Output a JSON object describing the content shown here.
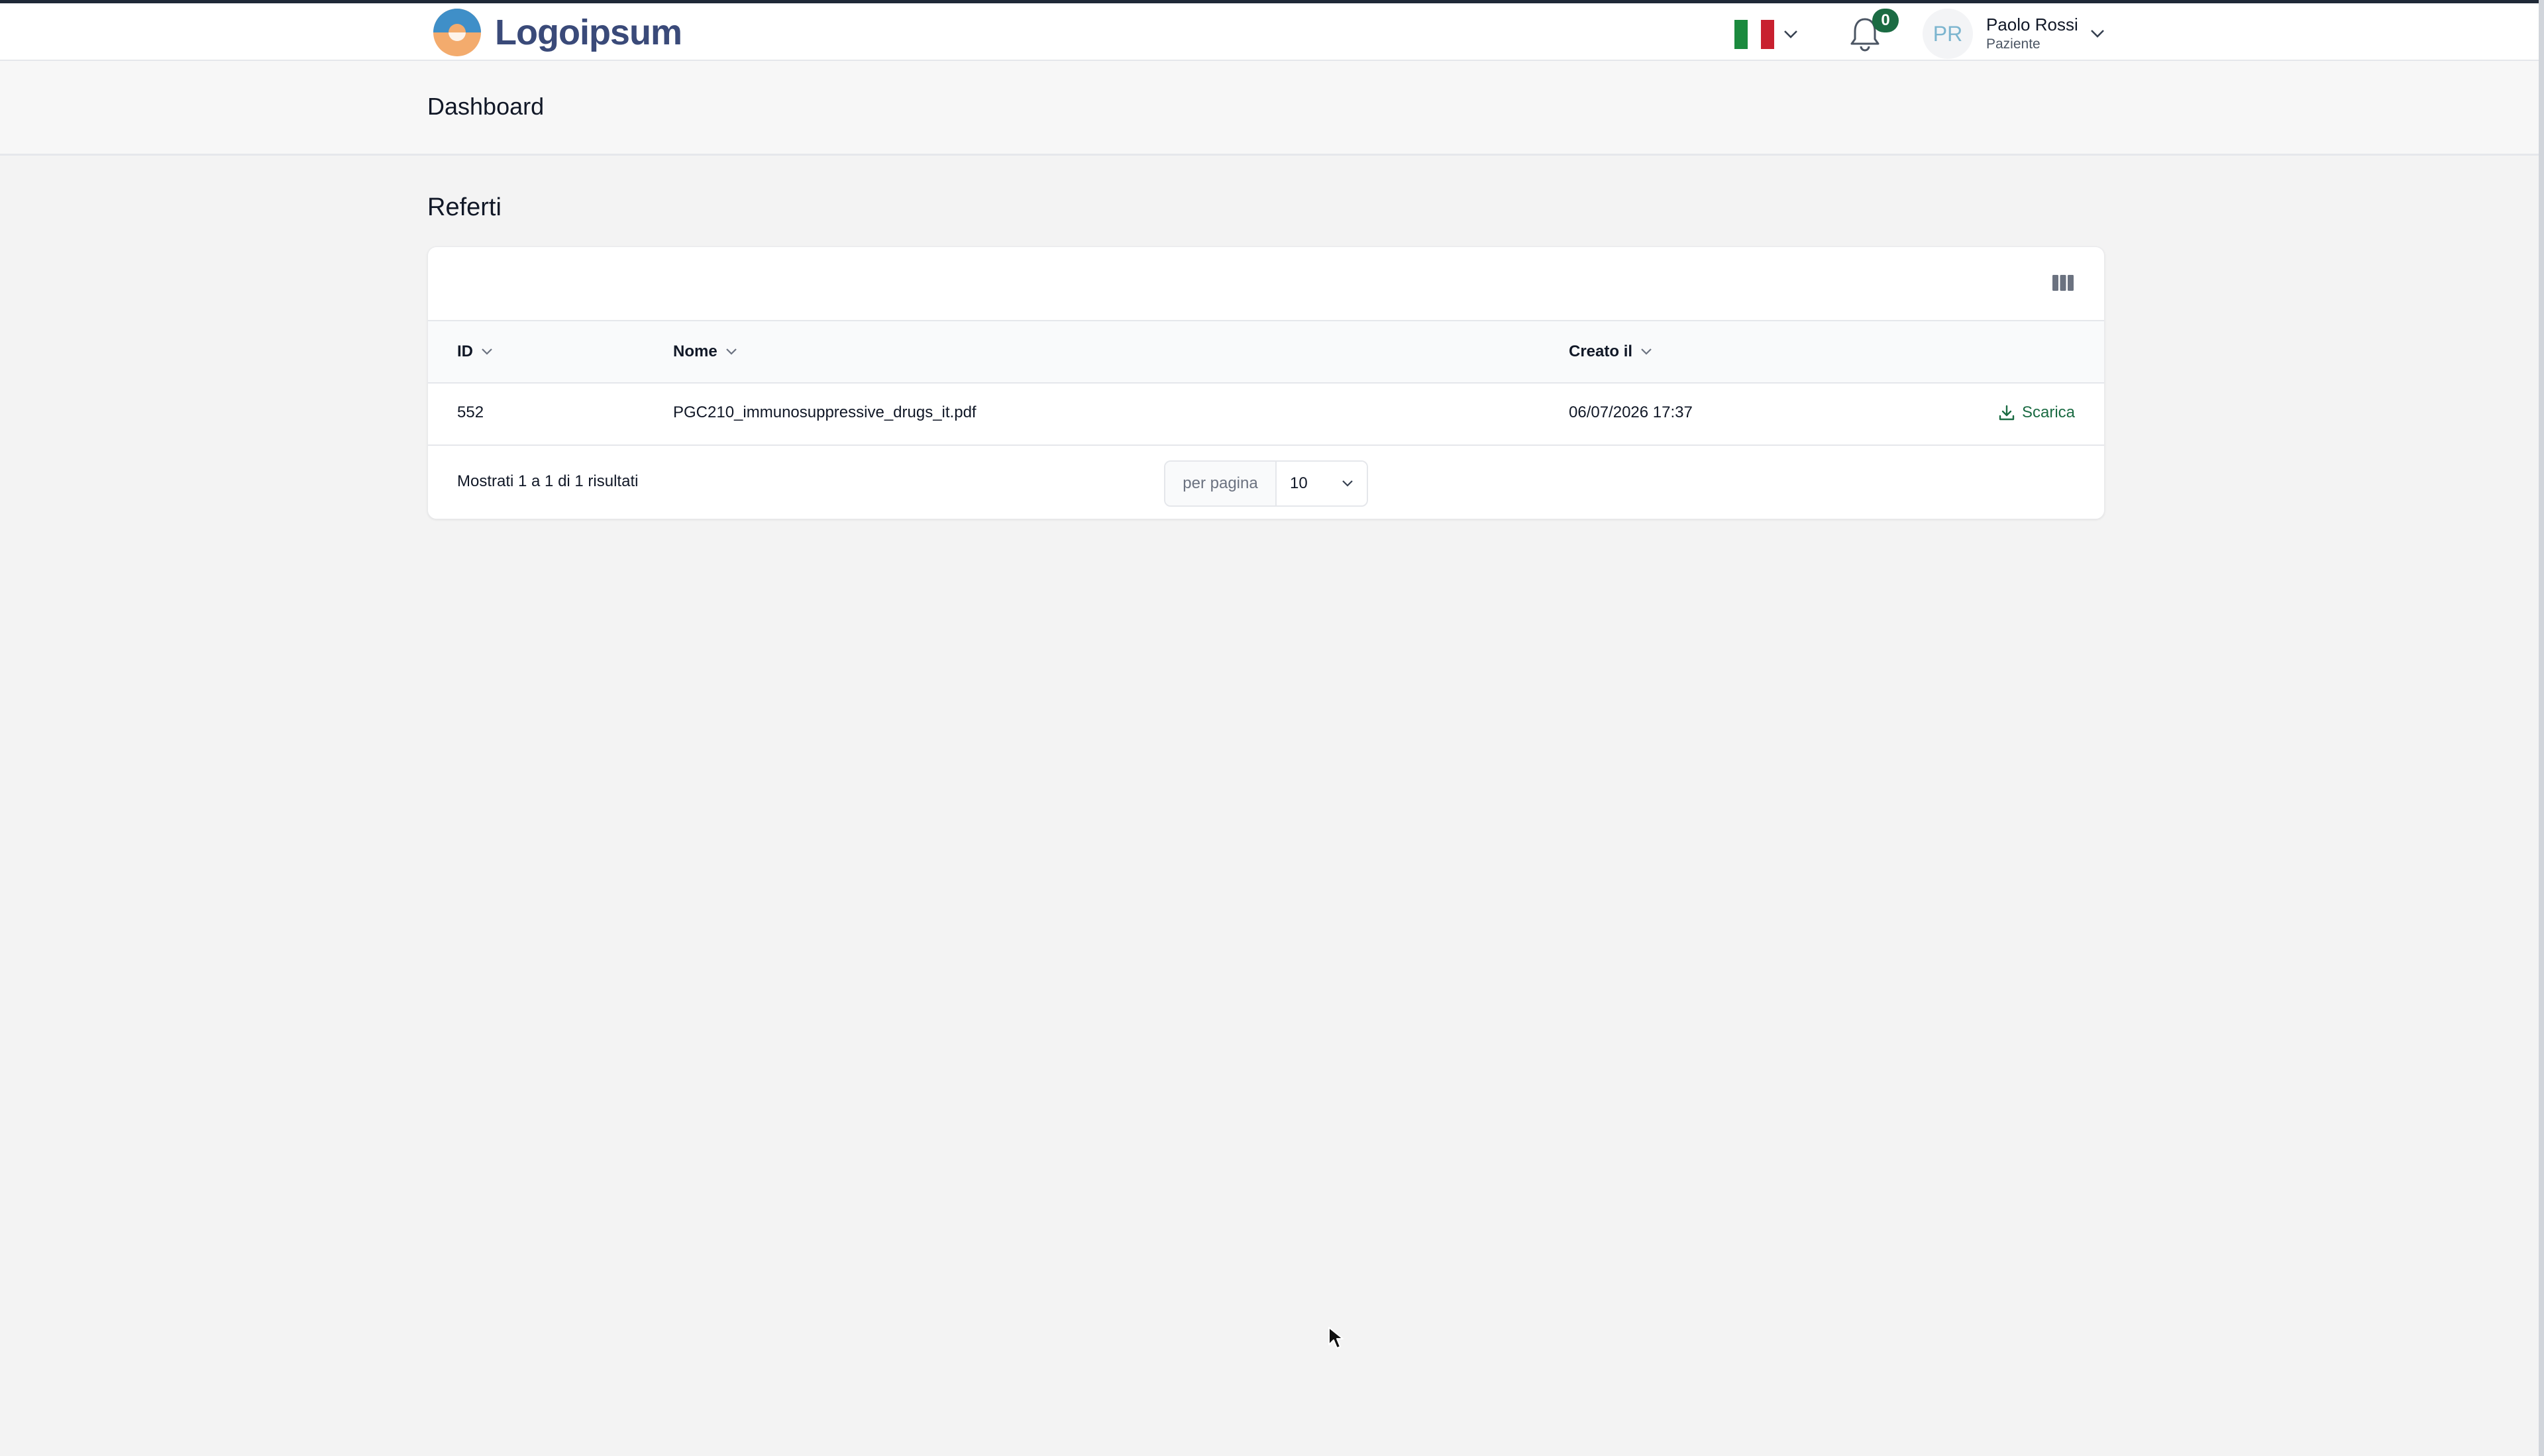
{
  "app": {
    "logo_text": "Logoipsum",
    "brand_color": "#3a4a79",
    "accent_color": "#1b6b43"
  },
  "header": {
    "language": {
      "flag": "italy-flag-icon",
      "flag_colors": [
        "#1b8a3e",
        "#ffffff",
        "#c8202f"
      ]
    },
    "notifications": {
      "icon": "bell-icon",
      "count": "0"
    },
    "user": {
      "initials": "PR",
      "name": "Paolo Rossi",
      "role": "Paziente"
    }
  },
  "page": {
    "title": "Dashboard",
    "section_title": "Referti"
  },
  "table": {
    "columns": [
      {
        "label": "ID"
      },
      {
        "label": "Nome"
      },
      {
        "label": "Creato il"
      }
    ],
    "rows": [
      {
        "id": "552",
        "name": "PGC210_immunosuppressive_drugs_it.pdf",
        "created": "06/07/2026 17:37",
        "action_label": "Scarica"
      }
    ],
    "footer": {
      "results_text": "Mostrati 1 a 1 di 1 risultati",
      "per_page_label": "per pagina",
      "per_page_value": "10"
    }
  }
}
